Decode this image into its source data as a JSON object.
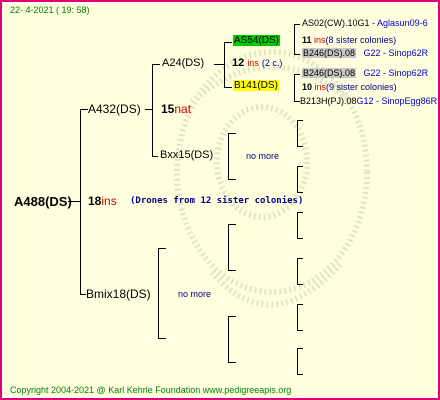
{
  "header": {
    "date": "22-  4-2021 ( 19: 58)"
  },
  "footer": {
    "copyright": "Copyright 2004-2021 @ Karl Kehrle Foundation   www.pedigreeapis.org"
  },
  "root": {
    "name": "A488(DS)",
    "number": "18",
    "suffix": "ins",
    "note": "(Drones from 12 sister colonies)"
  },
  "mother": {
    "name": "A432(DS)",
    "number": "15",
    "suffix": "nat"
  },
  "father": {
    "name": "Bmix18(DS)",
    "no_more": "no more"
  },
  "mm": {
    "name": "A24(DS)",
    "number": "12",
    "suffix": "ins",
    "note": "(2 c.)"
  },
  "mf": {
    "name": "Bxx15(DS)",
    "no_more": "no more"
  },
  "mmm": {
    "name": "AS54(DS)",
    "number": "11",
    "suffix": "ins",
    "note": "(8 sister colonies)"
  },
  "mmf": {
    "name": "B141(DS)",
    "number": "10",
    "suffix": "ins",
    "note": "(9 sister colonies)"
  },
  "g4": [
    {
      "name": "AS02(CW).10G1",
      "extra": "- Aglasun09-6"
    },
    {
      "name": "B246(DS).08",
      "extra": "G22 - Sinop62R"
    },
    {
      "name": "B246(DS).08",
      "extra": "G22 - Sinop62R"
    },
    {
      "name": "B213H(PJ).08",
      "extra": "G12 - SinopEgg86R"
    }
  ],
  "colors": {
    "frame": "#e0007a",
    "background": "#ffffe0",
    "green_box": "#00cc00",
    "yellow_box": "#ffff00",
    "grey_box": "#c8c8c8"
  }
}
